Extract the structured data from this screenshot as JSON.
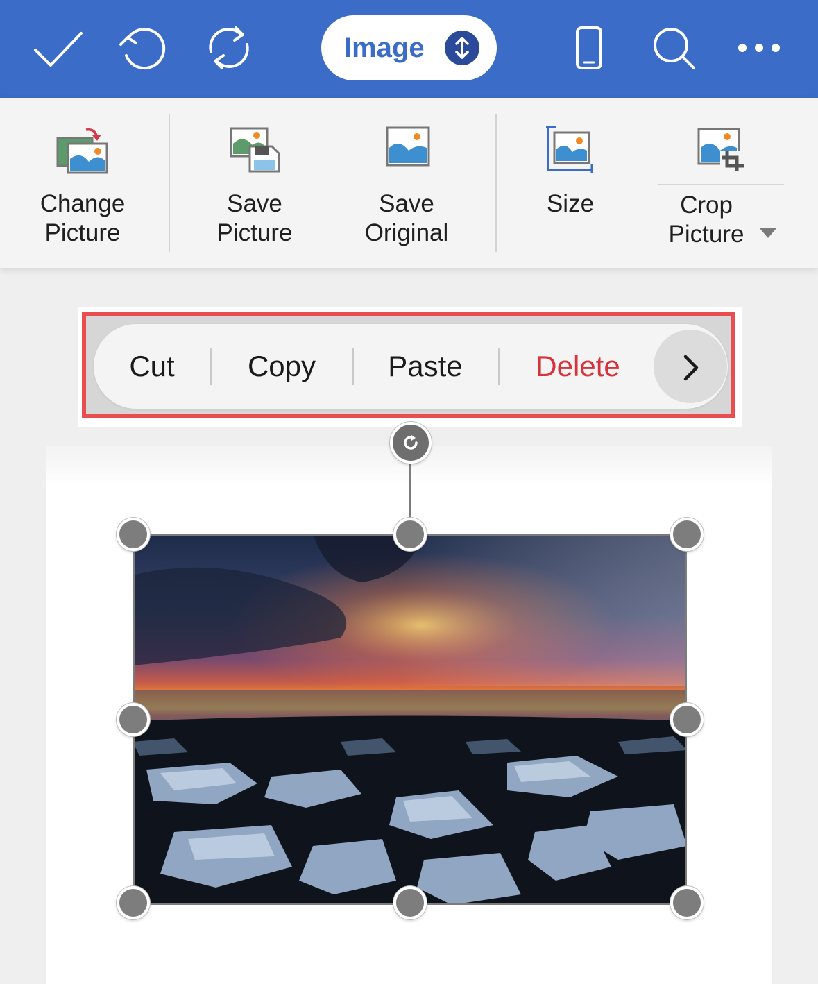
{
  "toolbar": {
    "mode_label": "Image",
    "icons": [
      "checkmark-icon",
      "undo-icon",
      "sync-icon",
      "phone-view-icon",
      "search-icon",
      "more-icon"
    ],
    "accent": "#3a6cc8"
  },
  "ribbon": {
    "items": [
      {
        "label": "Change\nPicture",
        "icon": "change-picture-icon"
      },
      {
        "label": "Save\nPicture",
        "icon": "save-picture-icon"
      },
      {
        "label": "Save\nOriginal",
        "icon": "save-original-icon"
      },
      {
        "label": "Size",
        "icon": "size-icon"
      },
      {
        "label": "Crop\nPicture",
        "icon": "crop-picture-icon"
      }
    ]
  },
  "context_menu": {
    "items": [
      {
        "label": "Cut"
      },
      {
        "label": "Copy"
      },
      {
        "label": "Paste"
      },
      {
        "label": "Delete",
        "color": "#d8323a"
      }
    ],
    "more_icon": "chevron-right-icon",
    "highlight_color": "#e84e50"
  },
  "document": {
    "image": "selected picture: sunset over ice chunks on black sand beach"
  }
}
